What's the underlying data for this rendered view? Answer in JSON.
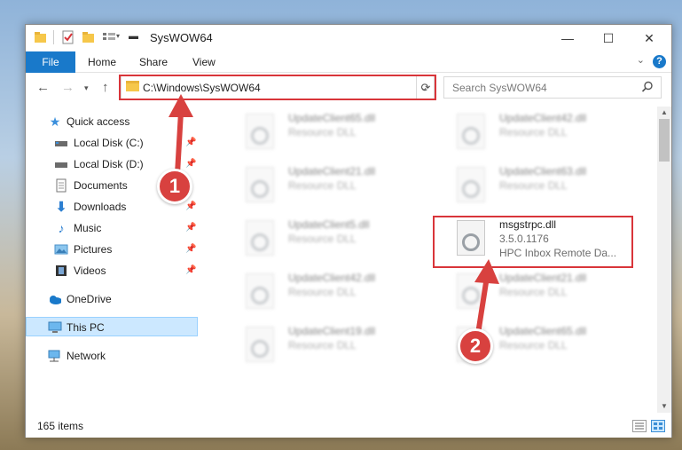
{
  "window": {
    "title": "SysWOW64"
  },
  "ribbon": {
    "tabs": [
      "File",
      "Home",
      "Share",
      "View"
    ]
  },
  "address": {
    "path": "C:\\Windows\\SysWOW64"
  },
  "search": {
    "placeholder": "Search SysWOW64"
  },
  "sidebar": {
    "items": [
      {
        "label": "Quick access",
        "icon": "star-icon"
      },
      {
        "label": "Local Disk (C:)",
        "icon": "drive-icon"
      },
      {
        "label": "Local Disk (D:)",
        "icon": "drive-icon"
      },
      {
        "label": "Documents",
        "icon": "document-icon"
      },
      {
        "label": "Downloads",
        "icon": "download-icon"
      },
      {
        "label": "Music",
        "icon": "music-icon"
      },
      {
        "label": "Pictures",
        "icon": "pictures-icon"
      },
      {
        "label": "Videos",
        "icon": "video-icon"
      },
      {
        "label": "OneDrive",
        "icon": "cloud-icon"
      },
      {
        "label": "This PC",
        "icon": "computer-icon"
      },
      {
        "label": "Network",
        "icon": "network-icon"
      }
    ]
  },
  "files": [
    {
      "name": "UpdateClient65.dll",
      "type": "Resource DLL"
    },
    {
      "name": "UpdateClient42.dll",
      "type": "Resource DLL"
    },
    {
      "name": "UpdateClient21.dll",
      "type": "Resource DLL"
    },
    {
      "name": "UpdateClient63.dll",
      "type": "Resource DLL"
    },
    {
      "name": "UpdateClient5.dll",
      "type": "Resource DLL"
    },
    {
      "name": "msgstrpc.dll",
      "version": "3.5.0.1176",
      "description": "HPC Inbox Remote Da..."
    },
    {
      "name": "UpdateClient42.dll",
      "type": "Resource DLL"
    },
    {
      "name": "UpdateClient21.dll",
      "type": "Resource DLL"
    },
    {
      "name": "UpdateClient19.dll",
      "type": "Resource DLL"
    },
    {
      "name": "UpdateClient65.dll",
      "type": "Resource DLL"
    }
  ],
  "status": {
    "item_count": "165 items"
  },
  "annotations": {
    "step1": "1",
    "step2": "2"
  },
  "colors": {
    "accent": "#1979ca",
    "highlight": "#d9353a"
  }
}
